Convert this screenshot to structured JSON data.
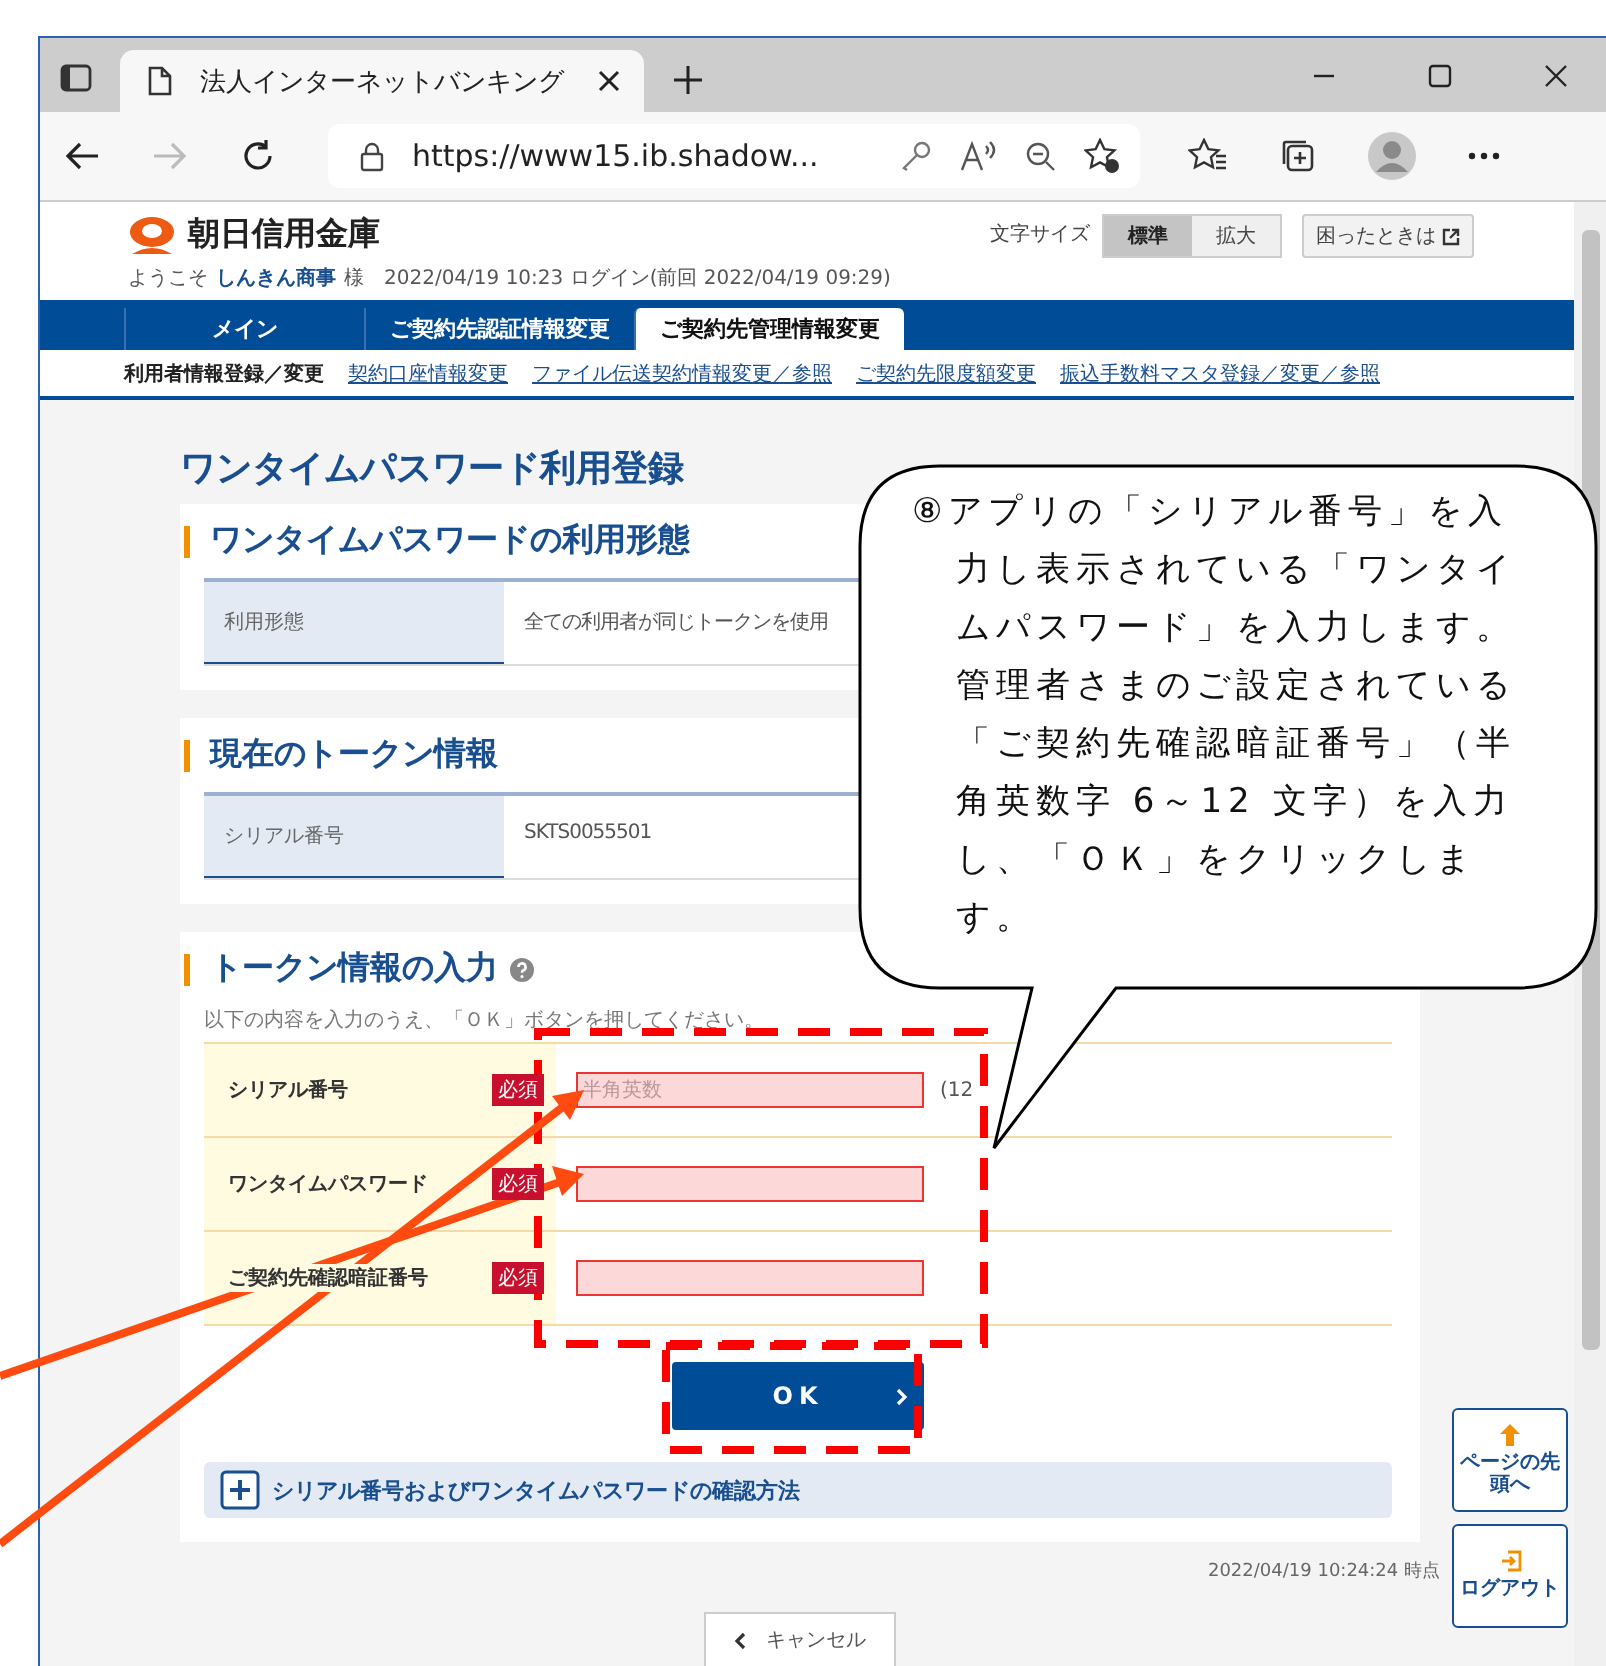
{
  "browser": {
    "tab_title": "法人インターネットバンキング",
    "url": "https://www15.ib.shadow..."
  },
  "header": {
    "bank_name": "朝日信用金庫",
    "text_size_label": "文字サイズ",
    "text_size_options": [
      {
        "label": "標準",
        "selected": true
      },
      {
        "label": "拡大",
        "selected": false
      }
    ],
    "help_button": "困ったときは",
    "welcome": "ようこそ",
    "user_name": "しんきん商事",
    "honorific": "様",
    "login_info": "2022/04/19 10:23 ログイン(前回 2022/04/19 09:29)"
  },
  "nav_tabs": [
    {
      "label": "メイン",
      "selected": false
    },
    {
      "label": "ご契約先認証情報変更",
      "selected": false
    },
    {
      "label": "ご契約先管理情報変更",
      "selected": true
    }
  ],
  "sub_nav": [
    {
      "label": "利用者情報登録／変更",
      "selected": true
    },
    {
      "label": "契約口座情報変更",
      "selected": false
    },
    {
      "label": "ファイル伝送契約情報変更／参照",
      "selected": false
    },
    {
      "label": "ご契約先限度額変更",
      "selected": false
    },
    {
      "label": "振込手数料マスタ登録／変更／参照",
      "selected": false
    }
  ],
  "page_title": "ワンタイムパスワード利用登録",
  "sections": [
    {
      "kind": "info",
      "heading": "ワンタイムパスワードの利用形態",
      "rows": [
        {
          "label": "利用形態",
          "value": "全ての利用者が同じトークンを使用"
        }
      ]
    },
    {
      "kind": "info",
      "heading": "現在のトークン情報",
      "rows": [
        {
          "label": "シリアル番号",
          "value": "SKTS0055501"
        }
      ]
    },
    {
      "kind": "form",
      "heading": "トークン情報の入力",
      "instruction": "以下の内容を入力のうえ、「ＯＫ」ボタンを押してください。",
      "fields": [
        {
          "label": "シリアル番号",
          "required_badge": "必須",
          "placeholder": "半角英数",
          "suffix": "(12"
        },
        {
          "label": "ワンタイムパスワード",
          "required_badge": "必須"
        },
        {
          "label": "ご契約先確認暗証番号",
          "required_badge": "必須"
        }
      ]
    }
  ],
  "ok_button": "OK",
  "expander": {
    "label": "シリアル番号およびワンタイムパスワードの確認方法",
    "expanded": false
  },
  "timestamp": "2022/04/19 10:24:24 時点",
  "cancel_button": "キャンセル",
  "side_buttons": [
    {
      "kind": "top",
      "label": "ページの先頭へ"
    },
    {
      "kind": "logout",
      "label": "ログアウト"
    }
  ],
  "callout": "⑧アプリの「シリアル番号」を入力し表示されている「ワンタイムパスワード」を入力します。管理者さまのご設定されている「ご契約先確認暗証番号」（半角英数字 6～12 文字）を入力し、「ＯＫ」をクリックします。"
}
